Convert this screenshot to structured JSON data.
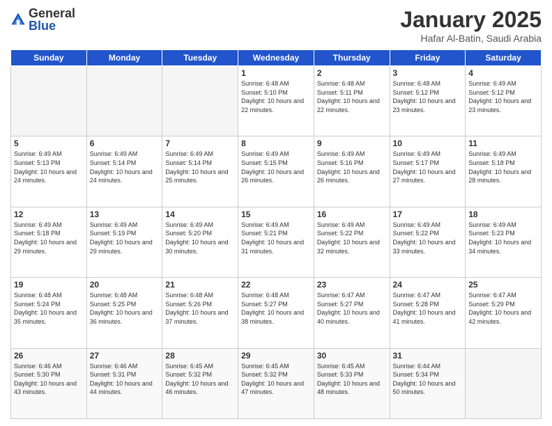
{
  "logo": {
    "general": "General",
    "blue": "Blue"
  },
  "title": "January 2025",
  "subtitle": "Hafar Al-Batin, Saudi Arabia",
  "headers": [
    "Sunday",
    "Monday",
    "Tuesday",
    "Wednesday",
    "Thursday",
    "Friday",
    "Saturday"
  ],
  "weeks": [
    [
      {
        "day": "",
        "info": ""
      },
      {
        "day": "",
        "info": ""
      },
      {
        "day": "",
        "info": ""
      },
      {
        "day": "1",
        "info": "Sunrise: 6:48 AM\nSunset: 5:10 PM\nDaylight: 10 hours\nand 22 minutes."
      },
      {
        "day": "2",
        "info": "Sunrise: 6:48 AM\nSunset: 5:11 PM\nDaylight: 10 hours\nand 22 minutes."
      },
      {
        "day": "3",
        "info": "Sunrise: 6:48 AM\nSunset: 5:12 PM\nDaylight: 10 hours\nand 23 minutes."
      },
      {
        "day": "4",
        "info": "Sunrise: 6:49 AM\nSunset: 5:12 PM\nDaylight: 10 hours\nand 23 minutes."
      }
    ],
    [
      {
        "day": "5",
        "info": "Sunrise: 6:49 AM\nSunset: 5:13 PM\nDaylight: 10 hours\nand 24 minutes."
      },
      {
        "day": "6",
        "info": "Sunrise: 6:49 AM\nSunset: 5:14 PM\nDaylight: 10 hours\nand 24 minutes."
      },
      {
        "day": "7",
        "info": "Sunrise: 6:49 AM\nSunset: 5:14 PM\nDaylight: 10 hours\nand 25 minutes."
      },
      {
        "day": "8",
        "info": "Sunrise: 6:49 AM\nSunset: 5:15 PM\nDaylight: 10 hours\nand 26 minutes."
      },
      {
        "day": "9",
        "info": "Sunrise: 6:49 AM\nSunset: 5:16 PM\nDaylight: 10 hours\nand 26 minutes."
      },
      {
        "day": "10",
        "info": "Sunrise: 6:49 AM\nSunset: 5:17 PM\nDaylight: 10 hours\nand 27 minutes."
      },
      {
        "day": "11",
        "info": "Sunrise: 6:49 AM\nSunset: 5:18 PM\nDaylight: 10 hours\nand 28 minutes."
      }
    ],
    [
      {
        "day": "12",
        "info": "Sunrise: 6:49 AM\nSunset: 5:18 PM\nDaylight: 10 hours\nand 29 minutes."
      },
      {
        "day": "13",
        "info": "Sunrise: 6:49 AM\nSunset: 5:19 PM\nDaylight: 10 hours\nand 29 minutes."
      },
      {
        "day": "14",
        "info": "Sunrise: 6:49 AM\nSunset: 5:20 PM\nDaylight: 10 hours\nand 30 minutes."
      },
      {
        "day": "15",
        "info": "Sunrise: 6:49 AM\nSunset: 5:21 PM\nDaylight: 10 hours\nand 31 minutes."
      },
      {
        "day": "16",
        "info": "Sunrise: 6:49 AM\nSunset: 5:22 PM\nDaylight: 10 hours\nand 32 minutes."
      },
      {
        "day": "17",
        "info": "Sunrise: 6:49 AM\nSunset: 5:22 PM\nDaylight: 10 hours\nand 33 minutes."
      },
      {
        "day": "18",
        "info": "Sunrise: 6:49 AM\nSunset: 5:23 PM\nDaylight: 10 hours\nand 34 minutes."
      }
    ],
    [
      {
        "day": "19",
        "info": "Sunrise: 6:48 AM\nSunset: 5:24 PM\nDaylight: 10 hours\nand 35 minutes."
      },
      {
        "day": "20",
        "info": "Sunrise: 6:48 AM\nSunset: 5:25 PM\nDaylight: 10 hours\nand 36 minutes."
      },
      {
        "day": "21",
        "info": "Sunrise: 6:48 AM\nSunset: 5:26 PM\nDaylight: 10 hours\nand 37 minutes."
      },
      {
        "day": "22",
        "info": "Sunrise: 6:48 AM\nSunset: 5:27 PM\nDaylight: 10 hours\nand 38 minutes."
      },
      {
        "day": "23",
        "info": "Sunrise: 6:47 AM\nSunset: 5:27 PM\nDaylight: 10 hours\nand 40 minutes."
      },
      {
        "day": "24",
        "info": "Sunrise: 6:47 AM\nSunset: 5:28 PM\nDaylight: 10 hours\nand 41 minutes."
      },
      {
        "day": "25",
        "info": "Sunrise: 6:47 AM\nSunset: 5:29 PM\nDaylight: 10 hours\nand 42 minutes."
      }
    ],
    [
      {
        "day": "26",
        "info": "Sunrise: 6:46 AM\nSunset: 5:30 PM\nDaylight: 10 hours\nand 43 minutes."
      },
      {
        "day": "27",
        "info": "Sunrise: 6:46 AM\nSunset: 5:31 PM\nDaylight: 10 hours\nand 44 minutes."
      },
      {
        "day": "28",
        "info": "Sunrise: 6:45 AM\nSunset: 5:32 PM\nDaylight: 10 hours\nand 46 minutes."
      },
      {
        "day": "29",
        "info": "Sunrise: 6:45 AM\nSunset: 5:32 PM\nDaylight: 10 hours\nand 47 minutes."
      },
      {
        "day": "30",
        "info": "Sunrise: 6:45 AM\nSunset: 5:33 PM\nDaylight: 10 hours\nand 48 minutes."
      },
      {
        "day": "31",
        "info": "Sunrise: 6:44 AM\nSunset: 5:34 PM\nDaylight: 10 hours\nand 50 minutes."
      },
      {
        "day": "",
        "info": ""
      }
    ]
  ]
}
